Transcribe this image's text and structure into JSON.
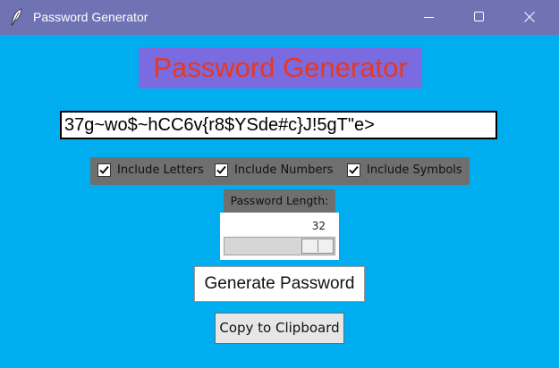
{
  "window": {
    "title": "Password Generator",
    "icon": "feather-icon"
  },
  "window_controls": {
    "minimize_icon": "minimize-icon",
    "maximize_icon": "maximize-icon",
    "close_icon": "close-icon"
  },
  "main": {
    "heading": "Password Generator",
    "password_value": "37g~wo$~hCC6v{r8$YSde#c}J!5gT\"e>",
    "options": [
      {
        "label": "Include Letters",
        "checked": true
      },
      {
        "label": "Include Numbers",
        "checked": true
      },
      {
        "label": "Include Symbols",
        "checked": true
      }
    ],
    "length_label": "Password Length:",
    "length_value": "32",
    "generate_label": "Generate Password",
    "copy_label": "Copy to Clipboard"
  },
  "colors": {
    "titlebar": "#6f73b4",
    "background": "#00adef",
    "heading_bg": "#7b6be0",
    "heading_text": "#e8381f",
    "panel_gray": "#6f6f6f"
  }
}
